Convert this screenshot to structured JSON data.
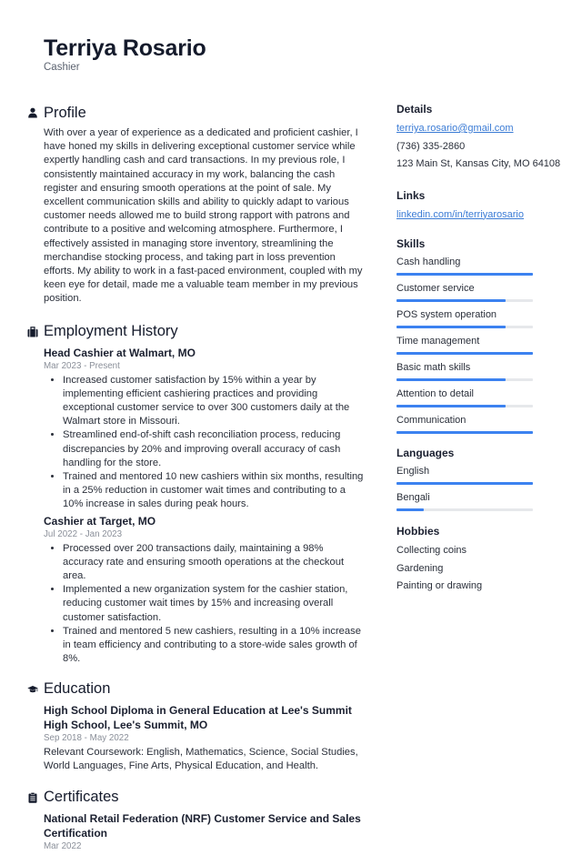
{
  "header": {
    "name": "Terriya Rosario",
    "title": "Cashier"
  },
  "profile": {
    "title": "Profile",
    "icon": "person-icon",
    "text": "With over a year of experience as a dedicated and proficient cashier, I have honed my skills in delivering exceptional customer service while expertly handling cash and card transactions. In my previous role, I consistently maintained accuracy in my work, balancing the cash register and ensuring smooth operations at the point of sale. My excellent communication skills and ability to quickly adapt to various customer needs allowed me to build strong rapport with patrons and contribute to a positive and welcoming atmosphere. Furthermore, I effectively assisted in managing store inventory, streamlining the merchandise stocking process, and taking part in loss prevention efforts. My ability to work in a fast-paced environment, coupled with my keen eye for detail, made me a valuable team member in my previous position."
  },
  "employment": {
    "title": "Employment History",
    "icon": "briefcase-icon",
    "jobs": [
      {
        "title": "Head Cashier at Walmart, MO",
        "date": "Mar 2023 - Present",
        "bullets": [
          "Increased customer satisfaction by 15% within a year by implementing efficient cashiering practices and providing exceptional customer service to over 300 customers daily at the Walmart store in Missouri.",
          "Streamlined end-of-shift cash reconciliation process, reducing discrepancies by 20% and improving overall accuracy of cash handling for the store.",
          "Trained and mentored 10 new cashiers within six months, resulting in a 25% reduction in customer wait times and contributing to a 10% increase in sales during peak hours."
        ]
      },
      {
        "title": "Cashier at Target, MO",
        "date": "Jul 2022 - Jan 2023",
        "bullets": [
          "Processed over 200 transactions daily, maintaining a 98% accuracy rate and ensuring smooth operations at the checkout area.",
          "Implemented a new organization system for the cashier station, reducing customer wait times by 15% and increasing overall customer satisfaction.",
          "Trained and mentored 5 new cashiers, resulting in a 10% increase in team efficiency and contributing to a store-wide sales growth of 8%."
        ]
      }
    ]
  },
  "education": {
    "title": "Education",
    "icon": "graduation-cap-icon",
    "entries": [
      {
        "title": "High School Diploma in General Education at Lee's Summit High School, Lee's Summit, MO",
        "date": "Sep 2018 - May 2022",
        "text": "Relevant Coursework: English, Mathematics, Science, Social Studies, World Languages, Fine Arts, Physical Education, and Health."
      }
    ]
  },
  "certificates": {
    "title": "Certificates",
    "icon": "clipboard-icon",
    "entries": [
      {
        "title": "National Retail Federation (NRF) Customer Service and Sales Certification",
        "date": "Mar 2022"
      }
    ]
  },
  "details": {
    "title": "Details",
    "email": "terriya.rosario@gmail.com",
    "phone": "(736) 335-2860",
    "address": "123 Main St, Kansas City, MO 64108"
  },
  "links": {
    "title": "Links",
    "items": [
      {
        "label": "linkedin.com/in/terriyarosario"
      }
    ]
  },
  "skills": {
    "title": "Skills",
    "items": [
      {
        "label": "Cash handling",
        "level": 1.0
      },
      {
        "label": "Customer service",
        "level": 0.8
      },
      {
        "label": "POS system operation",
        "level": 0.8
      },
      {
        "label": "Time management",
        "level": 1.0
      },
      {
        "label": "Basic math skills",
        "level": 0.8
      },
      {
        "label": "Attention to detail",
        "level": 0.8
      },
      {
        "label": "Communication",
        "level": 1.0
      }
    ]
  },
  "languages": {
    "title": "Languages",
    "items": [
      {
        "label": "English",
        "level": 1.0
      },
      {
        "label": "Bengali",
        "level": 0.2
      }
    ]
  },
  "hobbies": {
    "title": "Hobbies",
    "items": [
      "Collecting coins",
      "Gardening",
      "Painting or drawing"
    ]
  },
  "colors": {
    "accent": "#3c82f0",
    "track": "#e6e8eb",
    "heading": "#141a2b",
    "muted": "#8a8f99",
    "link": "#3a7bd5"
  }
}
